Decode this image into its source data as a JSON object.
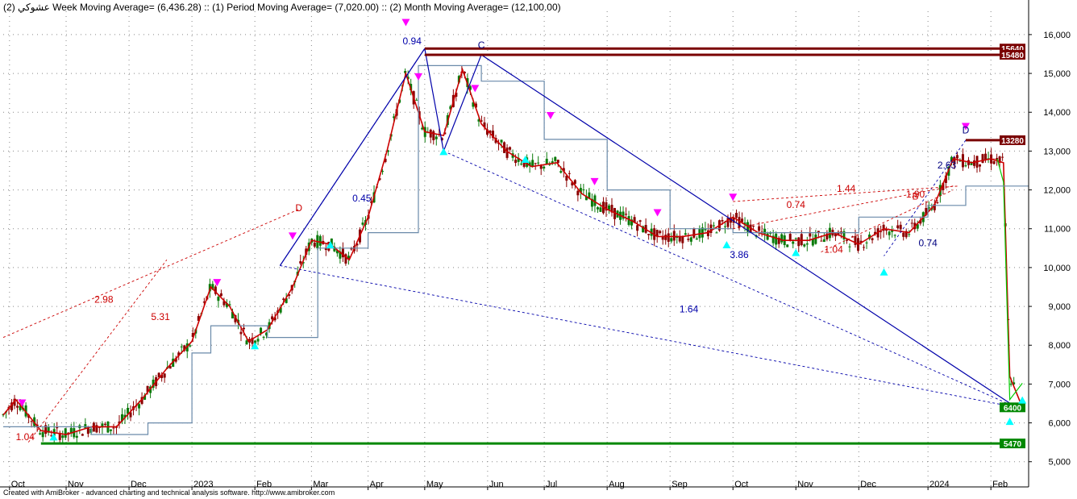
{
  "header": {
    "symbol": "عشوكي",
    "legend": "(2) Week Moving Average= (6,436.28) :: (1) Period Moving Average= (7,020.00) :: (2) Month Moving Average= (12,100.00)"
  },
  "footer": "Created with AmiBroker - advanced charting and technical analysis software. http://www.amibroker.com",
  "colors": {
    "price_up": "#0a7a0a",
    "price_down": "#8b0000",
    "week_ma": "#cc0000",
    "period_ma": "#00cc00",
    "month_ma": "#6a8aaa",
    "wave_line": "#0000aa",
    "resistance": "#7a0000",
    "support": "#008800",
    "sell_marker": "#ff00ff",
    "buy_marker": "#00ffff"
  },
  "chart_data": {
    "type": "line",
    "title": "",
    "ylim": [
      4600,
      16600
    ],
    "y_ticks": [
      5000,
      6000,
      7000,
      8000,
      9000,
      10000,
      11000,
      12000,
      13000,
      14000,
      15000,
      16000
    ],
    "y_tick_labels": [
      "5,000",
      "6,000",
      "7,000",
      "8,000",
      "9,000",
      "10,000",
      "11,000",
      "12,000",
      "13,000",
      "14,000",
      "15,000",
      "16,000"
    ],
    "x_range": [
      0,
      16.3
    ],
    "x_ticks": [
      {
        "x": 0.1,
        "label": "Oct"
      },
      {
        "x": 1.0,
        "label": "Nov"
      },
      {
        "x": 2.0,
        "label": "Dec"
      },
      {
        "x": 3.0,
        "label": "2023"
      },
      {
        "x": 4.0,
        "label": "Feb"
      },
      {
        "x": 4.9,
        "label": "Mar"
      },
      {
        "x": 5.8,
        "label": "Apr"
      },
      {
        "x": 6.7,
        "label": "May"
      },
      {
        "x": 7.7,
        "label": "Jun"
      },
      {
        "x": 8.6,
        "label": "Jul"
      },
      {
        "x": 9.6,
        "label": "Aug"
      },
      {
        "x": 10.6,
        "label": "Sep"
      },
      {
        "x": 11.6,
        "label": "Oct"
      },
      {
        "x": 12.6,
        "label": "Nov"
      },
      {
        "x": 13.6,
        "label": "Dec"
      },
      {
        "x": 14.7,
        "label": "2024"
      },
      {
        "x": 15.7,
        "label": "Feb"
      }
    ],
    "series": [
      {
        "name": "Week Moving Average",
        "key": "week",
        "values": [
          [
            0,
            6200
          ],
          [
            0.2,
            6600
          ],
          [
            0.6,
            5800
          ],
          [
            1.0,
            5700
          ],
          [
            1.4,
            5900
          ],
          [
            1.8,
            5900
          ],
          [
            2.2,
            6600
          ],
          [
            2.6,
            7400
          ],
          [
            3.0,
            8100
          ],
          [
            3.3,
            9500
          ],
          [
            3.6,
            9000
          ],
          [
            3.9,
            8100
          ],
          [
            4.2,
            8400
          ],
          [
            4.6,
            9500
          ],
          [
            4.9,
            10700
          ],
          [
            5.2,
            10600
          ],
          [
            5.5,
            10200
          ],
          [
            5.8,
            11300
          ],
          [
            6.1,
            13000
          ],
          [
            6.4,
            15000
          ],
          [
            6.7,
            13500
          ],
          [
            7.0,
            13400
          ],
          [
            7.3,
            15100
          ],
          [
            7.6,
            13700
          ],
          [
            8.0,
            13000
          ],
          [
            8.4,
            12600
          ],
          [
            8.8,
            12700
          ],
          [
            9.2,
            11900
          ],
          [
            9.6,
            11500
          ],
          [
            10.0,
            11200
          ],
          [
            10.4,
            10800
          ],
          [
            10.8,
            10800
          ],
          [
            11.2,
            10900
          ],
          [
            11.6,
            11300
          ],
          [
            12.0,
            10900
          ],
          [
            12.4,
            10700
          ],
          [
            12.8,
            10700
          ],
          [
            13.2,
            10900
          ],
          [
            13.6,
            10600
          ],
          [
            14.0,
            11000
          ],
          [
            14.4,
            10900
          ],
          [
            14.8,
            11600
          ],
          [
            15.1,
            12800
          ],
          [
            15.4,
            12700
          ],
          [
            15.7,
            12800
          ],
          [
            15.9,
            12700
          ],
          [
            16.0,
            7200
          ],
          [
            16.2,
            6400
          ]
        ]
      },
      {
        "name": "Period Moving Average",
        "key": "period",
        "values": [
          [
            15.8,
            12800
          ],
          [
            15.9,
            12200
          ],
          [
            16.0,
            6600
          ],
          [
            16.2,
            7020
          ]
        ]
      },
      {
        "name": "Month Moving Average",
        "key": "month",
        "values": [
          [
            0,
            5900
          ],
          [
            1.4,
            5900
          ],
          [
            1.4,
            5700
          ],
          [
            2.3,
            5700
          ],
          [
            2.3,
            6000
          ],
          [
            3.0,
            6000
          ],
          [
            3.0,
            7800
          ],
          [
            3.3,
            7800
          ],
          [
            3.3,
            8500
          ],
          [
            4.2,
            8500
          ],
          [
            4.2,
            8200
          ],
          [
            5.0,
            8200
          ],
          [
            5.0,
            10500
          ],
          [
            5.8,
            10500
          ],
          [
            5.8,
            10900
          ],
          [
            6.6,
            10900
          ],
          [
            6.6,
            15200
          ],
          [
            7.6,
            15200
          ],
          [
            7.6,
            14800
          ],
          [
            8.6,
            14800
          ],
          [
            8.6,
            13300
          ],
          [
            9.6,
            13300
          ],
          [
            9.6,
            12000
          ],
          [
            10.6,
            12000
          ],
          [
            10.6,
            11000
          ],
          [
            11.6,
            11000
          ],
          [
            11.6,
            10900
          ],
          [
            13.6,
            10900
          ],
          [
            13.6,
            11300
          ],
          [
            14.7,
            11300
          ],
          [
            14.7,
            11600
          ],
          [
            15.3,
            11600
          ],
          [
            15.3,
            12100
          ],
          [
            16.3,
            12100
          ]
        ]
      }
    ],
    "wave_lines": [
      {
        "from": [
          4.4,
          10050
        ],
        "to": [
          6.7,
          15640
        ],
        "style": "solid"
      },
      {
        "from": [
          6.7,
          15640
        ],
        "to": [
          7.0,
          13000
        ],
        "style": "solid"
      },
      {
        "from": [
          7.0,
          13000
        ],
        "to": [
          7.6,
          15480
        ],
        "style": "solid"
      },
      {
        "from": [
          7.6,
          15480
        ],
        "to": [
          16.1,
          6400
        ],
        "style": "solid"
      },
      {
        "from": [
          4.4,
          10050
        ],
        "to": [
          6.7,
          15640
        ],
        "style": "dashed"
      },
      {
        "from": [
          4.4,
          10050
        ],
        "to": [
          16.1,
          6400
        ],
        "style": "dashed"
      },
      {
        "from": [
          7.0,
          13000
        ],
        "to": [
          16.1,
          6400
        ],
        "style": "dashed"
      },
      {
        "from": [
          15.3,
          13280
        ],
        "to": [
          14.0,
          10300
        ],
        "style": "dashed"
      }
    ],
    "levels": [
      {
        "value": 15640,
        "label": "15640",
        "color": "#7a0000",
        "x_start": 6.7
      },
      {
        "value": 15480,
        "label": "15480",
        "color": "#7a0000",
        "x_start": 6.7
      },
      {
        "value": 13280,
        "label": "13280",
        "color": "#7a0000",
        "x_start": 15.3
      },
      {
        "value": 6400,
        "label": "6400",
        "color": "#008800",
        "x_start": 16.1
      },
      {
        "value": 5470,
        "label": "5470",
        "color": "#008800",
        "x_start": 0.6
      }
    ],
    "price_labels": [
      {
        "value": 12100,
        "label": "12,100",
        "bg": "#6a8aaa"
      },
      {
        "value": 7020,
        "label": "7,020",
        "bg": "#8b0000"
      },
      {
        "value": 6800,
        "label": "7,020",
        "bg": "#00cc00"
      },
      {
        "value": 6436.28,
        "label": "6,436.28",
        "bg": "#ee0000"
      }
    ],
    "annotations": [
      {
        "x": 6.5,
        "y": 15750,
        "text": "0.94",
        "color": "#0000aa"
      },
      {
        "x": 5.7,
        "y": 11700,
        "text": "0.45",
        "color": "#0000aa"
      },
      {
        "x": 11.7,
        "y": 10250,
        "text": "3.86",
        "color": "#0000aa"
      },
      {
        "x": 10.9,
        "y": 8850,
        "text": "1.64",
        "color": "#0000aa"
      },
      {
        "x": 1.6,
        "y": 9100,
        "text": "2.98",
        "color": "#cc0000"
      },
      {
        "x": 2.5,
        "y": 8650,
        "text": "5.31",
        "color": "#cc0000"
      },
      {
        "x": 0.35,
        "y": 5550,
        "text": "1.04",
        "color": "#cc0000"
      },
      {
        "x": 13.4,
        "y": 11950,
        "text": "1.44",
        "color": "#cc0000"
      },
      {
        "x": 12.6,
        "y": 11530,
        "text": "0.74",
        "color": "#cc0000"
      },
      {
        "x": 14.5,
        "y": 11800,
        "text": "1.90",
        "color": "#cc0000"
      },
      {
        "x": 13.2,
        "y": 10380,
        "text": "1.04",
        "color": "#cc0000"
      },
      {
        "x": 14.7,
        "y": 10550,
        "text": "0.74",
        "color": "#000080"
      },
      {
        "x": 15.0,
        "y": 12550,
        "text": "2.63",
        "color": "#000080"
      },
      {
        "x": 4.7,
        "y": 11450,
        "text": "D",
        "color": "#cc0000"
      },
      {
        "x": 15.3,
        "y": 13450,
        "text": "D",
        "color": "#000080"
      },
      {
        "x": 7.6,
        "y": 15650,
        "text": "C",
        "color": "#000080"
      },
      {
        "x": 14.5,
        "y": 11750,
        "text": "B",
        "color": "#cc0000"
      }
    ],
    "sell_markers": [
      [
        6.4,
        16300
      ],
      [
        15.3,
        13620
      ],
      [
        0.3,
        6500
      ],
      [
        6.6,
        14900
      ],
      [
        7.5,
        14600
      ],
      [
        8.7,
        13900
      ],
      [
        3.4,
        9600
      ],
      [
        4.6,
        10800
      ],
      [
        11.6,
        11800
      ],
      [
        9.4,
        12200
      ],
      [
        10.4,
        11400
      ]
    ],
    "buy_markers": [
      [
        0.8,
        5650
      ],
      [
        4.0,
        8000
      ],
      [
        5.2,
        10600
      ],
      [
        7.0,
        13000
      ],
      [
        11.5,
        10600
      ],
      [
        12.6,
        10400
      ],
      [
        14.0,
        9900
      ],
      [
        16.0,
        6050
      ],
      [
        16.2,
        6600
      ],
      [
        8.3,
        12800
      ]
    ],
    "candles": {
      "start": 0.0,
      "end": 16.1
    }
  }
}
